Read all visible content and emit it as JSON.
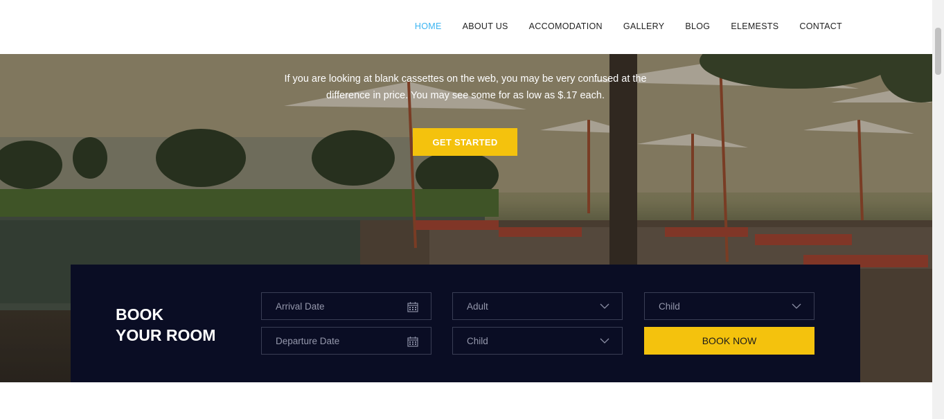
{
  "nav": {
    "items": [
      {
        "label": "HOME",
        "active": true
      },
      {
        "label": "ABOUT US",
        "active": false
      },
      {
        "label": "ACCOMODATION",
        "active": false
      },
      {
        "label": "GALLERY",
        "active": false
      },
      {
        "label": "BLOG",
        "active": false
      },
      {
        "label": "ELEMESTS",
        "active": false
      },
      {
        "label": "CONTACT",
        "active": false
      }
    ],
    "active_color": "#3ab4f2"
  },
  "hero": {
    "line1": "If you are looking at blank cassettes on the web, you may be very confused at the",
    "line2": "difference in price. You may see some for as low as $.17 each.",
    "cta_label": "GET STARTED",
    "cta_color": "#f4c20d"
  },
  "booking": {
    "title_line1": "BOOK",
    "title_line2": "YOUR ROOM",
    "arrival_placeholder": "Arrival Date",
    "departure_placeholder": "Departure Date",
    "adult_select": "Adult",
    "child_select_1": "Child",
    "child_select_2": "Child",
    "book_label": "BOOK NOW",
    "panel_color": "#0a0d24"
  }
}
